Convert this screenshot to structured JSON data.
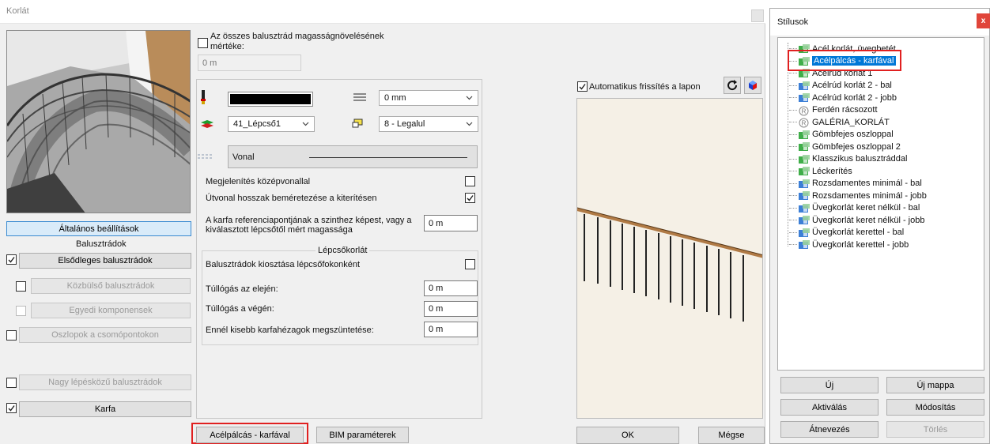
{
  "window": {
    "title": "Korlát"
  },
  "left": {
    "general_settings": "Általános beállítások",
    "balustrades_heading": "Balusztrádok",
    "primary": "Elsődleges balusztrádok",
    "intermediate": "Közbülső balusztrádok",
    "custom_components": "Egyedi komponensek",
    "posts_at_nodes": "Oszlopok a csomópontokon",
    "large_step": "Nagy lépésközű balusztrádok",
    "handrail": "Karfa"
  },
  "middle": {
    "height_increase_label": "Az összes balusztrád magasságnövelésének mértéke:",
    "height_increase_value": "0 m",
    "pen_thickness_value": "0 mm",
    "layer_value": "41_Lépcső1",
    "order_value": "8 - Legalul",
    "linetype_value": "Vonal",
    "centerline_label": "Megjelenítés középvonallal",
    "path_length_label": "Útvonal hosszak beméretezése a kiterítésen",
    "handrail_ref_label_1": "A karfa referenciapontjának a szinthez képest, vagy a",
    "handrail_ref_label_2": "kiválasztott lépcsőtől mért magassága",
    "handrail_ref_value": "0 m",
    "stair_rail_group": "Lépcsőkorlát",
    "distribute_label": "Balusztrádok kiosztása lépcsőfokonként",
    "overhang_start_label": "Túllógás az elején:",
    "overhang_start_value": "0 m",
    "overhang_end_label": "Túllógás a végén:",
    "overhang_end_value": "0 m",
    "gap_remove_label": "Ennél kisebb karfahézagok megszüntetése:",
    "gap_remove_value": "0 m",
    "style_button": "Acélpálcás - karfával",
    "bim_button": "BIM paraméterek"
  },
  "preview": {
    "auto_refresh_label": "Automatikus frissítés a lapon",
    "ok": "OK",
    "cancel": "Mégse"
  },
  "styles": {
    "title": "Stílusok",
    "close": "x",
    "items": [
      "Acél korlát, üvegbetét",
      "Acélpálcás - karfával",
      "Acélrúd korlát 1",
      "Acélrúd korlát 2 - bal",
      "Acélrúd korlát 2 - jobb",
      "Ferdén rácsozott",
      "GALÉRIA_KORLÁT",
      "Gömbfejes oszloppal",
      "Gömbfejes oszloppal 2",
      "Klasszikus balusztráddal",
      "Léckerítés",
      "Rozsdamentes minimál - bal",
      "Rozsdamentes minimál - jobb",
      "Üvegkorlát keret nélkül - bal",
      "Üvegkorlát keret nélkül - jobb",
      "Üvegkorlát kerettel - bal",
      "Üvegkorlát kerettel - jobb"
    ],
    "new": "Új",
    "new_folder": "Új mappa",
    "activate": "Aktiválás",
    "modify": "Módosítás",
    "rename": "Átnevezés",
    "delete": "Törlés"
  }
}
